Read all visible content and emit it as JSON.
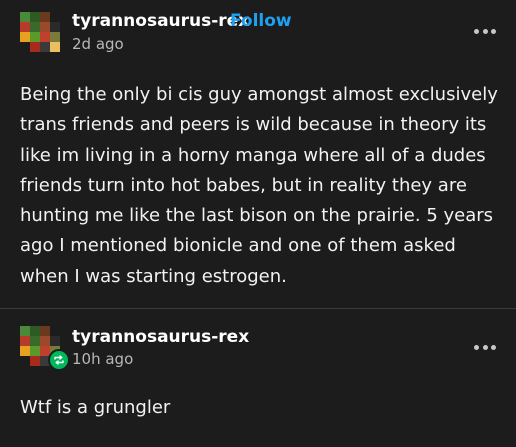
{
  "post": {
    "username": "tyrannosaurus-rex",
    "follow_label": "Follow",
    "timestamp": "2d ago",
    "body": "Being the only bi cis guy amongst almost exclusively trans friends and peers is wild because in theory its like im living in a horny manga where all of a dudes friends turn into hot babes, but in reality they are hunting me like the last bison on the prairie. 5 years ago I mentioned bionicle and one of them asked when I was starting estrogen."
  },
  "reblog": {
    "username": "tyrannosaurus-rex",
    "timestamp": "10h ago",
    "body": "Wtf is a grungler"
  },
  "icons": {
    "more": "more-options-icon",
    "reblog": "reblog-icon"
  },
  "colors": {
    "background": "#1c1c1c",
    "follow": "#1ea1f1",
    "reblog_badge": "#00b85c",
    "timestamp": "#b8b8b8"
  }
}
